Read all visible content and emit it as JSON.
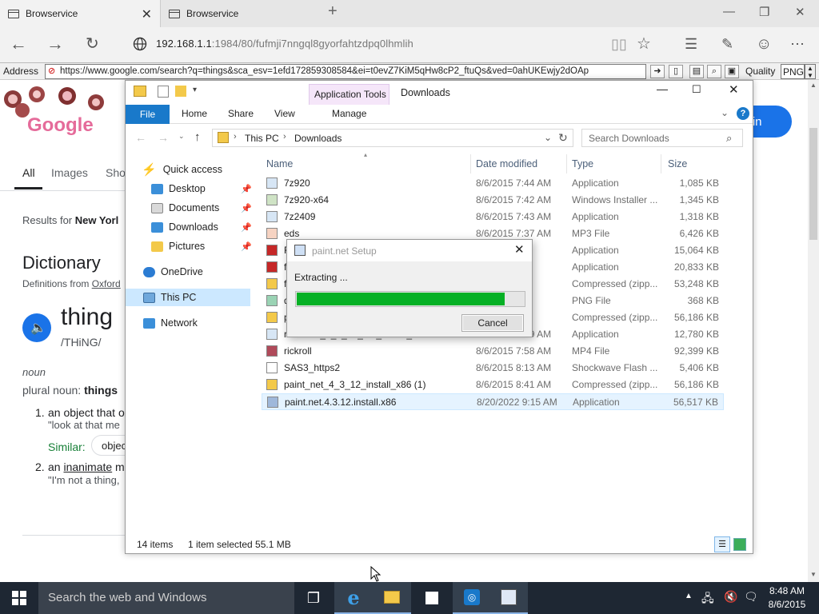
{
  "browser": {
    "tabs": [
      {
        "title": "Browservice"
      },
      {
        "title": "Browservice"
      }
    ],
    "url_host": "192.168.1.1",
    "url_rest": ":1984/80/fufmji7nngql8gyorfahtzdpq0lhmlih",
    "address_label": "Address",
    "address_value": "https://www.google.com/search?q=things&sca_esv=1efd172859308584&ei=t0evZ7KiM5qHw8cP2_ftuQs&ved=0ahUKEwjy2dOAp",
    "quality_label": "Quality",
    "quality_value": "PNG"
  },
  "google": {
    "tabs": [
      "All",
      "Images",
      "Sho"
    ],
    "results_for_prefix": "Results for ",
    "results_for_place": "New Yorl",
    "sign_in": "gn in",
    "dictionary_title": "Dictionary",
    "definitions_from": "Definitions from ",
    "definitions_source": "Oxford",
    "word": "thing",
    "phonetic": "/THiNG/",
    "pos": "noun",
    "plural_label": "plural noun: ",
    "plural_value": "things",
    "def1_num": "1.",
    "def1_text": "an object that o",
    "def1_example": "\"look at that me",
    "similar_label": "Similar:",
    "similar_chip": "objec",
    "def2_num": "2.",
    "def2_prefix": "an ",
    "def2_link": "inanimate",
    "def2_rest": " m",
    "def2_example": "\"I'm not a thing,"
  },
  "explorer": {
    "context_tab": "Application Tools",
    "title": "Downloads",
    "ribbon_tabs": [
      "File",
      "Home",
      "Share",
      "View",
      "Manage"
    ],
    "breadcrumb": [
      "This PC",
      "Downloads"
    ],
    "search_placeholder": "Search Downloads",
    "nav": {
      "quick_access": "Quick access",
      "items": [
        "Desktop",
        "Documents",
        "Downloads",
        "Pictures"
      ],
      "onedrive": "OneDrive",
      "this_pc": "This PC",
      "network": "Network"
    },
    "columns": [
      "Name",
      "Date modified",
      "Type",
      "Size"
    ],
    "files": [
      {
        "name": "7z920",
        "date": "8/6/2015 7:44 AM",
        "type": "Application",
        "size": "1,085 KB",
        "icon": "app-icon"
      },
      {
        "name": "7z920-x64",
        "date": "8/6/2015 7:42 AM",
        "type": "Windows Installer ...",
        "size": "1,345 KB",
        "icon": "installer-icon"
      },
      {
        "name": "7z2409",
        "date": "8/6/2015 7:43 AM",
        "type": "Application",
        "size": "1,318 KB",
        "icon": "app-icon"
      },
      {
        "name": "eds",
        "date": "8/6/2015 7:37 AM",
        "type": "MP3 File",
        "size": "6,426 KB",
        "icon": "audio-icon"
      },
      {
        "name": "F",
        "date": "",
        "type": "Application",
        "size": "15,064 KB",
        "icon": "flash-icon"
      },
      {
        "name": "f",
        "date": "",
        "type": "Application",
        "size": "20,833 KB",
        "icon": "flash-icon"
      },
      {
        "name": "f",
        "date": "",
        "type": "Compressed (zipp...",
        "size": "53,248 KB",
        "icon": "zip-icon"
      },
      {
        "name": "d",
        "date": "",
        "type": "PNG File",
        "size": "368 KB",
        "icon": "image-icon"
      },
      {
        "name": "p",
        "date": "",
        "type": "Compressed (zipp...",
        "size": "56,186 KB",
        "icon": "zip-icon"
      },
      {
        "name": "retrozilla_2_2_en_US_win32_insta",
        "date": "8/6/2015 7:29 AM",
        "type": "Application",
        "size": "12,780 KB",
        "icon": "app-icon"
      },
      {
        "name": "rickroll",
        "date": "8/6/2015 7:58 AM",
        "type": "MP4 File",
        "size": "92,399 KB",
        "icon": "video-icon"
      },
      {
        "name": "SAS3_https2",
        "date": "8/6/2015 8:13 AM",
        "type": "Shockwave Flash ...",
        "size": "5,406 KB",
        "icon": "file-icon"
      },
      {
        "name": "paint_net_4_3_12_install_x86 (1)",
        "date": "8/6/2015 8:41 AM",
        "type": "Compressed (zipp...",
        "size": "56,186 KB",
        "icon": "zip-icon"
      },
      {
        "name": "paint.net.4.3.12.install.x86",
        "date": "8/20/2022 9:15 AM",
        "type": "Application",
        "size": "56,517 KB",
        "icon": "paintnet-icon"
      }
    ],
    "status_items": "14 items",
    "status_selected": "1 item selected  55.1 MB"
  },
  "dialog": {
    "title": "paint.net Setup",
    "message": "Extracting ...",
    "progress_fraction": 0.91,
    "cancel_label": "Cancel"
  },
  "taskbar": {
    "search_placeholder": "Search the web and Windows",
    "time": "8:48 AM",
    "date": "8/6/2015"
  }
}
